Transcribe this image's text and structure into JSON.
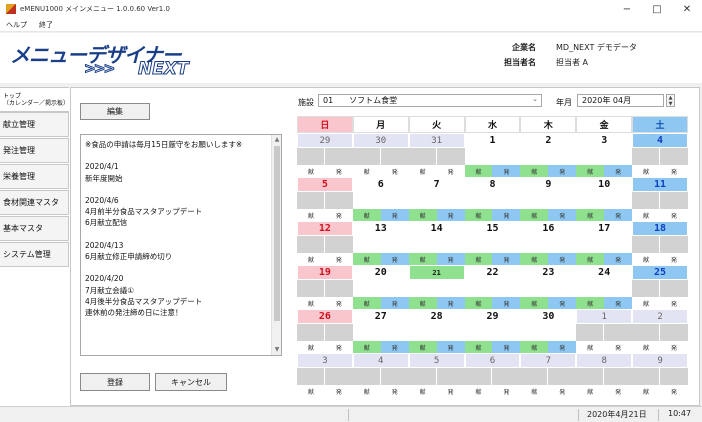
{
  "window": {
    "title": "eMENU1000 メインメニュー 1.0.0.60  Ver1.0",
    "minimize": "−",
    "maximize": "□",
    "close": "✕"
  },
  "menu": [
    "ヘルプ",
    "終了"
  ],
  "logo": {
    "main": "メニューデザイナー",
    "arrows": ">>>",
    "sub": "NEXT"
  },
  "company": {
    "label": "企業名",
    "value": "MD_NEXT デモデータ"
  },
  "person": {
    "label": "担当者名",
    "value": "担当者 A"
  },
  "sidebar": {
    "active_lines": [
      "トップ",
      "（カレンダー／掲示板）"
    ],
    "items": [
      "献立管理",
      "発注管理",
      "栄養管理",
      "食材関連マスタ",
      "基本マスタ",
      "システム管理"
    ]
  },
  "buttons": {
    "edit": "編集",
    "register": "登録",
    "cancel": "キャンセル"
  },
  "notice": {
    "text": "※食品の申請は毎月15日厳守をお願いします※\n\n2020/4/1\n新年度開始\n\n2020/4/6\n4月前半分食品マスタアップデート\n6月献立配信\n\n2020/4/13\n6月献立修正申請締め切り\n\n2020/4/20\n7月献立会議①\n4月後半分食品マスタアップデート\n連休前の発注締め日に注意！"
  },
  "facility": {
    "label": "施設",
    "value": "01　　ソフトム食堂"
  },
  "yearmonth": {
    "label": "年月",
    "value": "2020年 04月"
  },
  "calendar": {
    "weekdays": [
      "日",
      "月",
      "火",
      "水",
      "木",
      "金",
      "土"
    ],
    "tag_left": "献",
    "tag_right": "発",
    "weeks": [
      [
        {
          "d": "29",
          "t": "other"
        },
        {
          "d": "30",
          "t": "other"
        },
        {
          "d": "31",
          "t": "other"
        },
        {
          "d": "1",
          "t": "plain"
        },
        {
          "d": "2",
          "t": "plain"
        },
        {
          "d": "3",
          "t": "plain"
        },
        {
          "d": "4",
          "t": "sat"
        }
      ],
      [
        {
          "d": "5",
          "t": "sun"
        },
        {
          "d": "6",
          "t": "plain"
        },
        {
          "d": "7",
          "t": "plain"
        },
        {
          "d": "8",
          "t": "plain"
        },
        {
          "d": "9",
          "t": "plain"
        },
        {
          "d": "10",
          "t": "plain"
        },
        {
          "d": "11",
          "t": "sat"
        }
      ],
      [
        {
          "d": "12",
          "t": "sun"
        },
        {
          "d": "13",
          "t": "plain"
        },
        {
          "d": "14",
          "t": "plain"
        },
        {
          "d": "15",
          "t": "plain"
        },
        {
          "d": "16",
          "t": "plain"
        },
        {
          "d": "17",
          "t": "plain"
        },
        {
          "d": "18",
          "t": "sat"
        }
      ],
      [
        {
          "d": "19",
          "t": "sun"
        },
        {
          "d": "20",
          "t": "plain"
        },
        {
          "d": "21",
          "t": "hol"
        },
        {
          "d": "22",
          "t": "plain"
        },
        {
          "d": "23",
          "t": "plain"
        },
        {
          "d": "24",
          "t": "plain"
        },
        {
          "d": "25",
          "t": "sat"
        }
      ],
      [
        {
          "d": "26",
          "t": "sun"
        },
        {
          "d": "27",
          "t": "plain"
        },
        {
          "d": "28",
          "t": "plain"
        },
        {
          "d": "29",
          "t": "plain"
        },
        {
          "d": "30",
          "t": "plain"
        },
        {
          "d": "1",
          "t": "other"
        },
        {
          "d": "2",
          "t": "other"
        }
      ],
      [
        {
          "d": "3",
          "t": "other"
        },
        {
          "d": "4",
          "t": "other"
        },
        {
          "d": "5",
          "t": "other"
        },
        {
          "d": "6",
          "t": "other"
        },
        {
          "d": "7",
          "t": "other"
        },
        {
          "d": "8",
          "t": "other"
        },
        {
          "d": "9",
          "t": "other"
        }
      ]
    ]
  },
  "status": {
    "date": "2020年4月21日",
    "time": "10:47"
  }
}
